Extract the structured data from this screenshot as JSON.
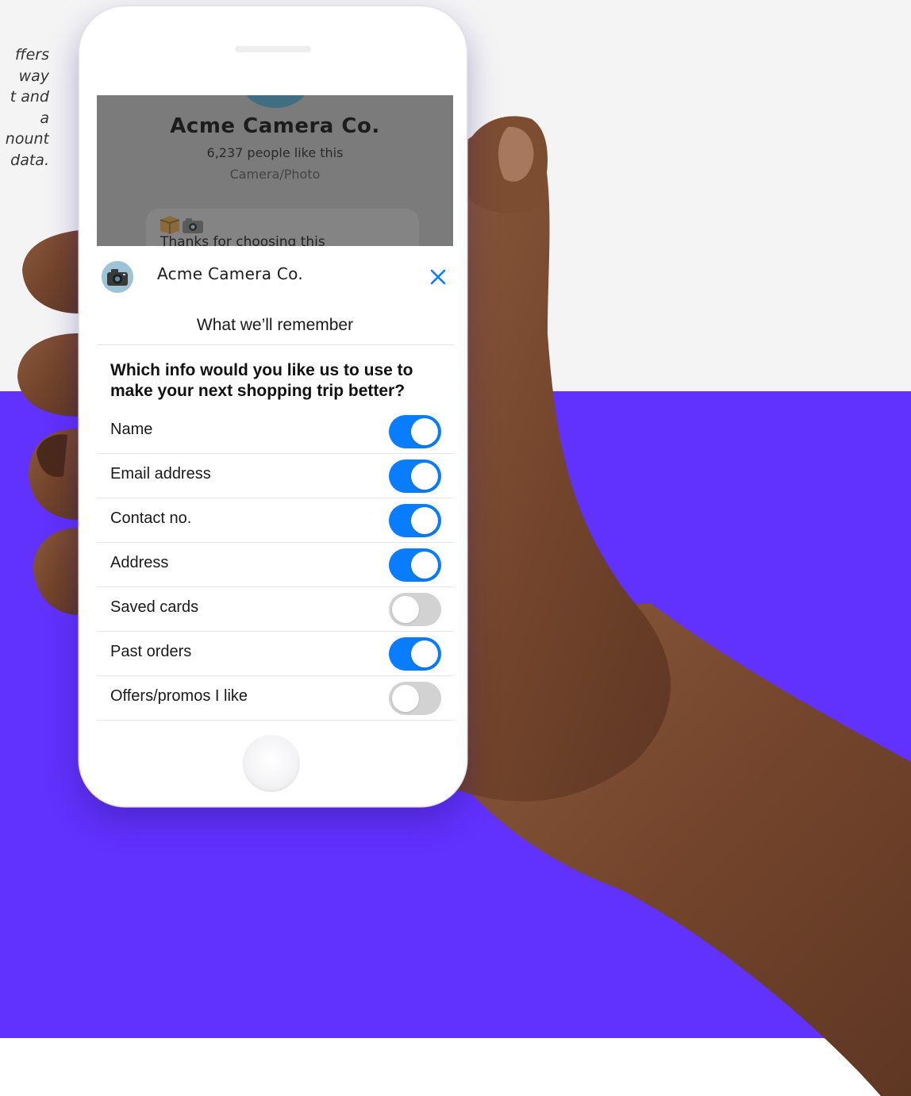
{
  "caption": {
    "lines": [
      "ffers",
      "way",
      "t and",
      "a",
      "nount",
      "data."
    ]
  },
  "background_page": {
    "title": "Acme Camera Co.",
    "likes": "6,237 people like this",
    "category": "Camera/Photo",
    "bubble_text": "Thanks for choosing this"
  },
  "sheet": {
    "brand_name": "Acme Camera Co.",
    "title": "What we’ll remember",
    "question": "Which info would you like us to use to make your next shopping trip better?",
    "accent_color": "#0a7cff",
    "options": [
      {
        "label": "Name",
        "enabled": true
      },
      {
        "label": "Email address",
        "enabled": true
      },
      {
        "label": "Contact no.",
        "enabled": true
      },
      {
        "label": "Address",
        "enabled": true
      },
      {
        "label": "Saved cards",
        "enabled": false
      },
      {
        "label": "Past orders",
        "enabled": true
      },
      {
        "label": "Offers/promos I like",
        "enabled": false
      }
    ]
  },
  "icons": {
    "close": "close-icon",
    "avatar": "camera-avatar"
  },
  "colors": {
    "band": "#6131fd",
    "background": "#f4f4f5"
  }
}
